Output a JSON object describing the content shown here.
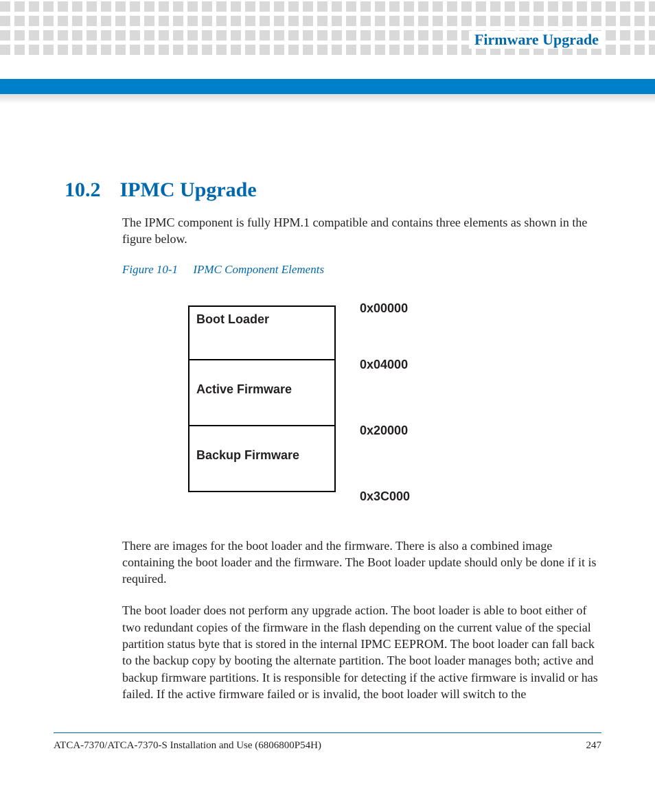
{
  "header": {
    "chapter_title": "Firmware Upgrade"
  },
  "section": {
    "number": "10.2",
    "title": "IPMC Upgrade",
    "intro": "The IPMC component is fully HPM.1 compatible and contains three elements as shown in the figure below."
  },
  "figure": {
    "number": "Figure 10-1",
    "caption": "IPMC Component Elements",
    "blocks": {
      "bootloader": "Boot Loader",
      "active": "Active Firmware",
      "backup": "Backup Firmware"
    },
    "addresses": {
      "a0": "0x00000",
      "a1": "0x04000",
      "a2": "0x20000",
      "a3": "0x3C000"
    }
  },
  "paragraphs": {
    "p1": "There are images for the boot loader and the firmware. There is also a combined image containing the boot loader and the firmware. The Boot loader update should only be done if it is required.",
    "p2": "The boot loader does not perform any upgrade action. The boot loader is able to boot either of two redundant copies of the firmware in the flash depending on the current value of the special partition status byte that is stored in the internal IPMC EEPROM. The boot loader can fall back to the backup copy by booting the alternate partition. The boot loader manages both; active and backup firmware partitions. It is responsible for detecting if the active firmware is invalid or has failed. If the active firmware failed or is invalid, the boot loader will switch to the"
  },
  "footer": {
    "doc_title": "ATCA-7370/ATCA-7370-S Installation and Use (6806800P54H)",
    "page": "247"
  }
}
